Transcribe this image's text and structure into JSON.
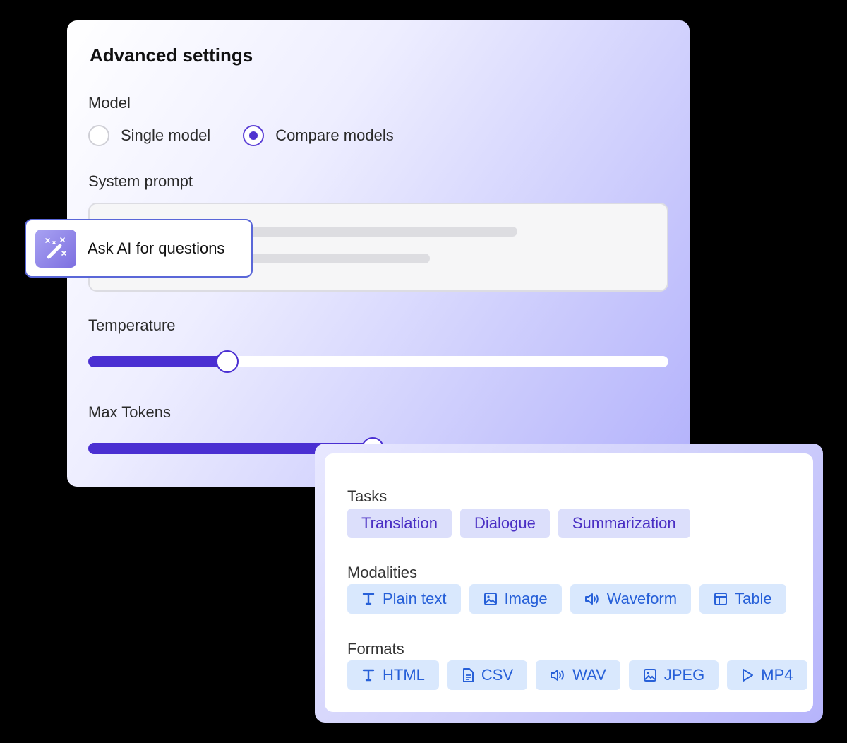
{
  "settings": {
    "title": "Advanced settings",
    "model_label": "Model",
    "model_options": [
      {
        "label": "Single model",
        "selected": false
      },
      {
        "label": "Compare models",
        "selected": true
      }
    ],
    "system_prompt_label": "System prompt",
    "temperature_label": "Temperature",
    "temperature_value": 0.24,
    "max_tokens_label": "Max Tokens",
    "max_tokens_value": 0.49
  },
  "ask_ai": {
    "label": "Ask AI for questions",
    "icon": "magic-wand-icon"
  },
  "panel": {
    "tasks_label": "Tasks",
    "tasks": [
      "Translation",
      "Dialogue",
      "Summarization"
    ],
    "modalities_label": "Modalities",
    "modalities": [
      {
        "label": "Plain text",
        "icon": "text-icon"
      },
      {
        "label": "Image",
        "icon": "image-icon"
      },
      {
        "label": "Waveform",
        "icon": "audio-icon"
      },
      {
        "label": "Table",
        "icon": "table-icon"
      }
    ],
    "formats_label": "Formats",
    "formats": [
      {
        "label": "HTML",
        "icon": "text-icon"
      },
      {
        "label": "CSV",
        "icon": "document-icon"
      },
      {
        "label": "WAV",
        "icon": "audio-icon"
      },
      {
        "label": "JPEG",
        "icon": "image-icon"
      },
      {
        "label": "MP4",
        "icon": "play-icon"
      }
    ]
  },
  "colors": {
    "accent": "#4a2fd2",
    "task_chip_bg": "#dcdffb",
    "task_chip_text": "#4a2fc4",
    "modality_chip_bg": "#d9e8fd",
    "modality_chip_text": "#2760d8",
    "ask_ai_border": "#5a67d8"
  }
}
